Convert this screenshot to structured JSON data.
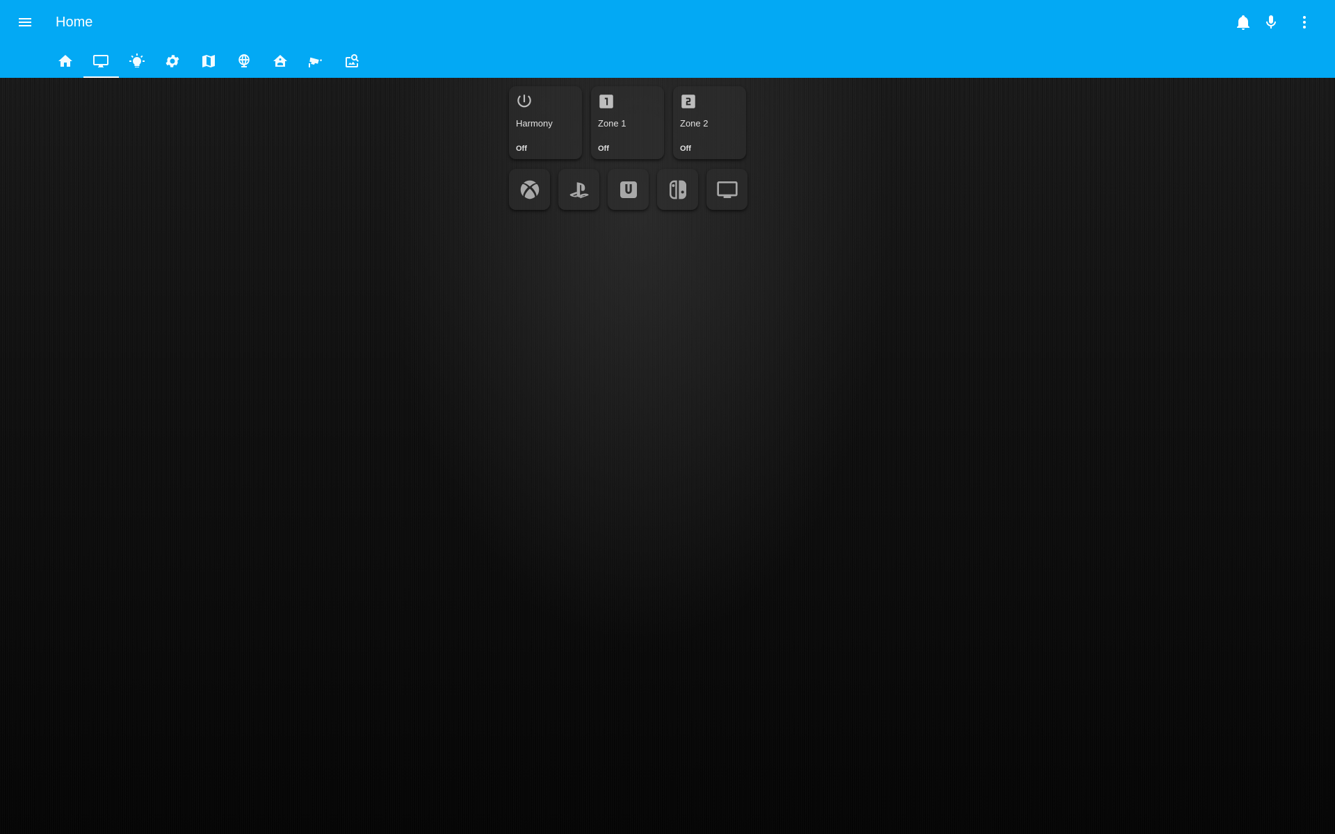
{
  "header": {
    "title": "Home",
    "accent_color": "#03a9f4",
    "menu_icon": "menu-icon",
    "actions": [
      {
        "name": "notifications-button",
        "icon": "bell-icon"
      },
      {
        "name": "voice-button",
        "icon": "microphone-icon"
      },
      {
        "name": "overflow-menu-button",
        "icon": "dots-vertical-icon"
      }
    ]
  },
  "tabs": [
    {
      "icon": "home-icon",
      "active": false
    },
    {
      "icon": "monitor-icon",
      "active": true
    },
    {
      "icon": "lightbulb-icon",
      "active": false
    },
    {
      "icon": "gear-icon",
      "active": false
    },
    {
      "icon": "map-icon",
      "active": false
    },
    {
      "icon": "globe-network-icon",
      "active": false
    },
    {
      "icon": "home-automation-icon",
      "active": false
    },
    {
      "icon": "cctv-icon",
      "active": false
    },
    {
      "icon": "image-search-icon",
      "active": false
    }
  ],
  "cards": [
    {
      "name": "Harmony",
      "state": "Off",
      "icon": "power-icon"
    },
    {
      "name": "Zone 1",
      "state": "Off",
      "icon": "numeric-1-box-icon"
    },
    {
      "name": "Zone 2",
      "state": "Off",
      "icon": "numeric-2-box-icon"
    }
  ],
  "activities": [
    {
      "icon": "xbox-icon"
    },
    {
      "icon": "playstation-icon"
    },
    {
      "icon": "wii-u-icon"
    },
    {
      "icon": "nintendo-switch-icon"
    },
    {
      "icon": "television-icon"
    }
  ]
}
